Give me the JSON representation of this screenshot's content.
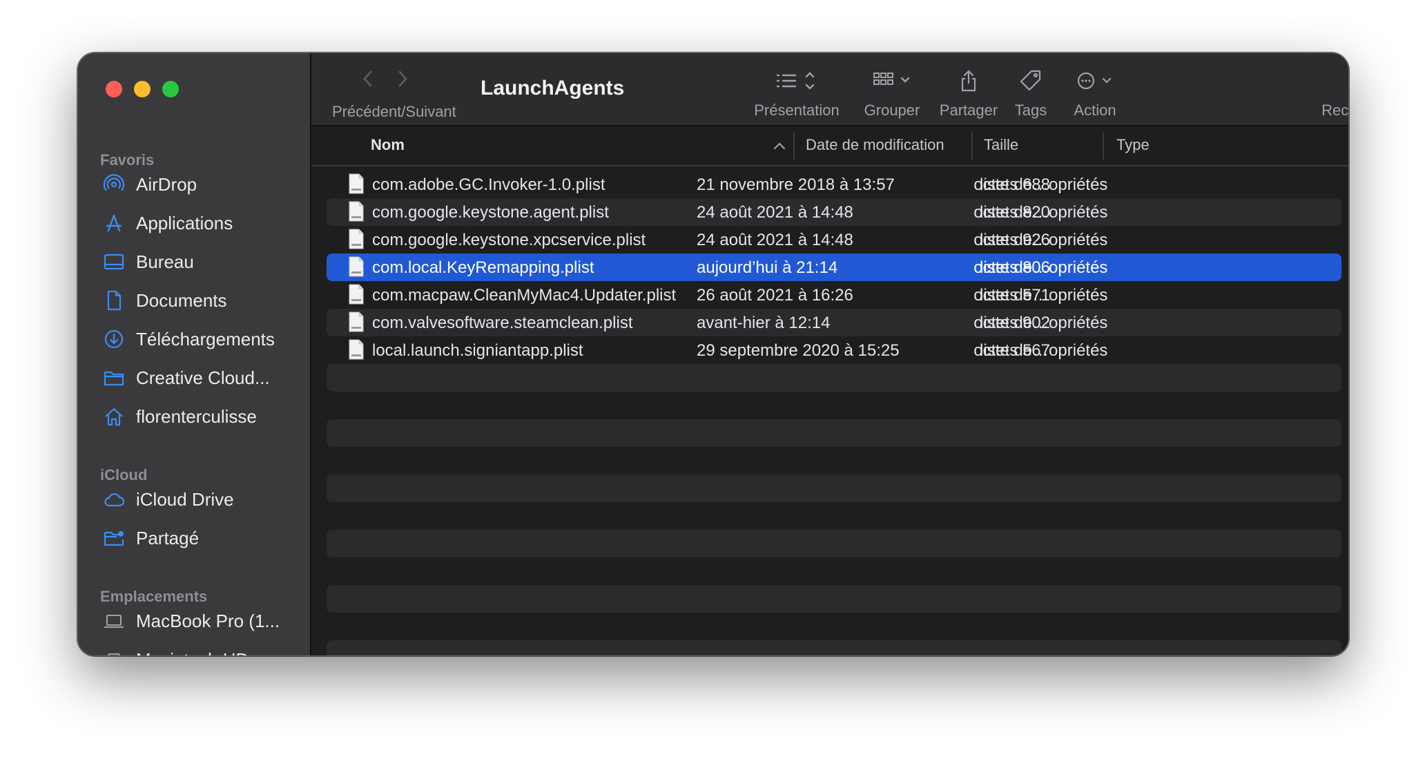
{
  "window": {
    "title": "LaunchAgents",
    "nav_label": "Précédent/Suivant"
  },
  "toolbar": {
    "presentation": "Présentation",
    "grouper": "Grouper",
    "partager": "Partager",
    "tags": "Tags",
    "action": "Action",
    "rechercher": "Rechercher"
  },
  "sidebar": {
    "sections": {
      "favoris": "Favoris",
      "icloud": "iCloud",
      "emplacements": "Emplacements"
    },
    "favoris": [
      {
        "label": "AirDrop",
        "icon": "airdrop-icon"
      },
      {
        "label": "Applications",
        "icon": "applications-icon"
      },
      {
        "label": "Bureau",
        "icon": "desktop-icon"
      },
      {
        "label": "Documents",
        "icon": "document-icon"
      },
      {
        "label": "Téléchargements",
        "icon": "download-icon"
      },
      {
        "label": "Creative Cloud...",
        "icon": "folder-icon"
      },
      {
        "label": "florenterculisse",
        "icon": "home-icon"
      }
    ],
    "icloud": [
      {
        "label": "iCloud Drive",
        "icon": "cloud-icon"
      },
      {
        "label": "Partagé",
        "icon": "shared-folder-icon"
      }
    ],
    "emplacements": [
      {
        "label": "MacBook Pro (1...",
        "icon": "laptop-icon"
      },
      {
        "label": "Macintosh HD",
        "icon": "disk-icon"
      }
    ]
  },
  "columns": {
    "name": "Nom",
    "date": "Date de modification",
    "size": "Taille",
    "type": "Type"
  },
  "files": [
    {
      "name": "com.adobe.GC.Invoker-1.0.plist",
      "date": "21 novembre 2018 à 13:57",
      "size": "688 octets",
      "type": "liste de…opriétés"
    },
    {
      "name": "com.google.keystone.agent.plist",
      "date": "24 août 2021 à 14:48",
      "size": "820 octets",
      "type": "liste de…opriétés"
    },
    {
      "name": "com.google.keystone.xpcservice.plist",
      "date": "24 août 2021 à 14:48",
      "size": "926 octets",
      "type": "liste de…opriétés"
    },
    {
      "name": "com.local.KeyRemapping.plist",
      "date": "aujourd’hui à 21:14",
      "size": "806 octets",
      "type": "liste de…opriétés"
    },
    {
      "name": "com.macpaw.CleanMyMac4.Updater.plist",
      "date": "26 août 2021 à 16:26",
      "size": "571 octets",
      "type": "liste de…opriétés"
    },
    {
      "name": "com.valvesoftware.steamclean.plist",
      "date": "avant-hier à 12:14",
      "size": "902 octets",
      "type": "liste de…opriétés"
    },
    {
      "name": "local.launch.signiantapp.plist",
      "date": "29 septembre 2020 à 15:25",
      "size": "567 octets",
      "type": "liste de…opriétés"
    }
  ],
  "colors": {
    "selection": "#2159d4",
    "sidebar_icon": "#3b8cf5",
    "close": "#ff5f57",
    "minimize": "#febc2e",
    "zoom": "#28c840"
  }
}
